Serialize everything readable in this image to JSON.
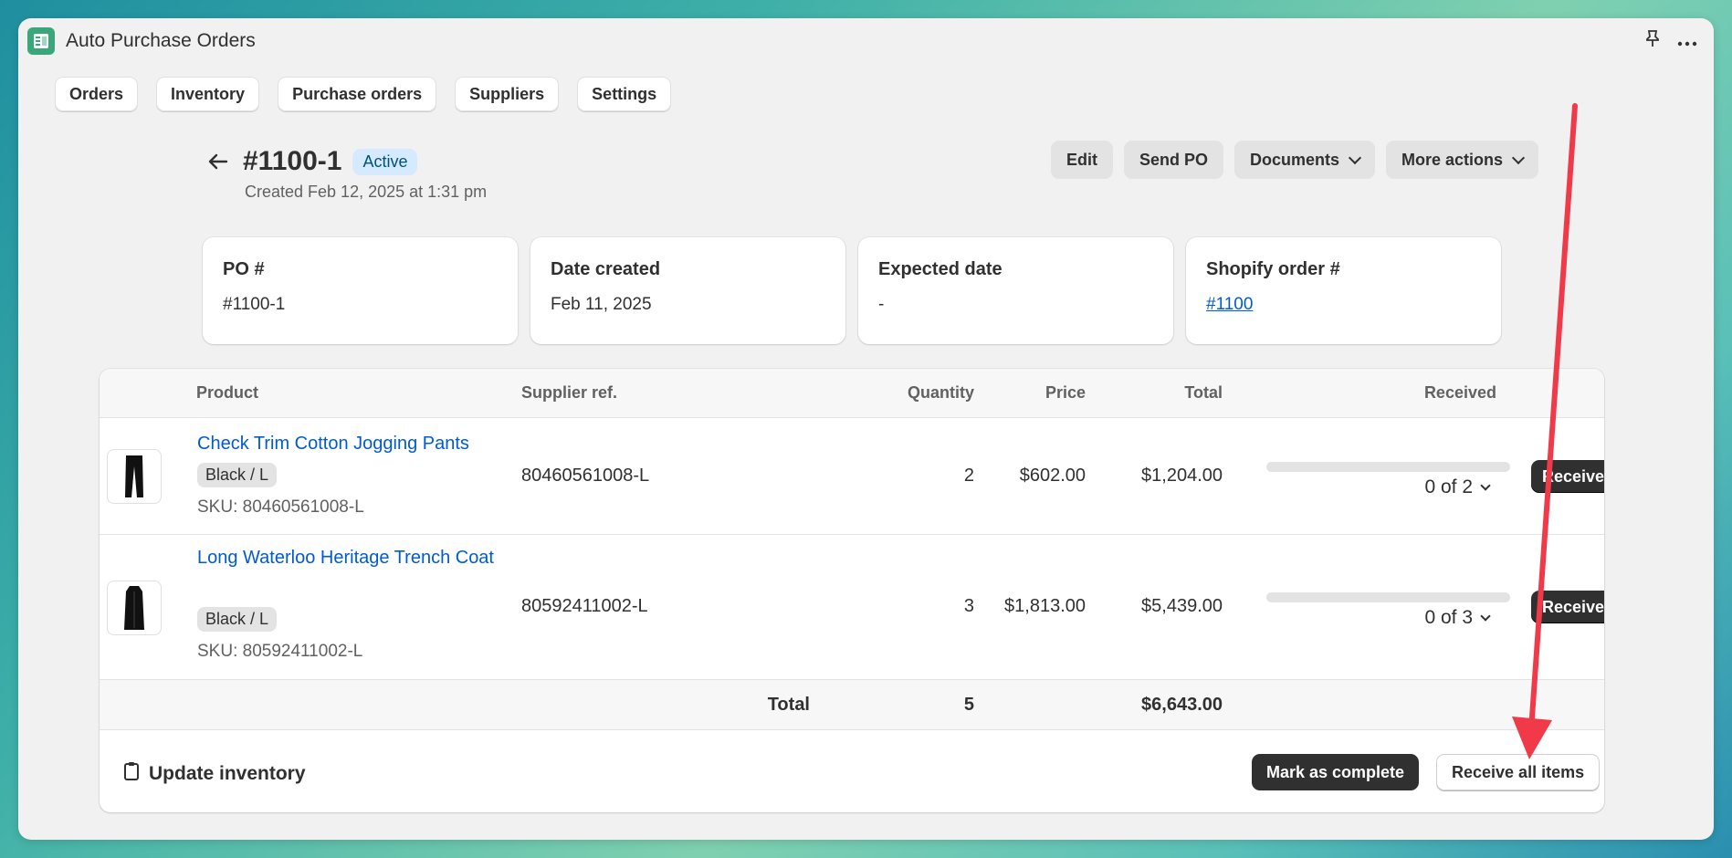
{
  "app": {
    "title": "Auto Purchase Orders"
  },
  "titlebar": {
    "pin_icon": "pin-icon",
    "more_icon": "more-horizontal-icon"
  },
  "nav": {
    "tabs": [
      "Orders",
      "Inventory",
      "Purchase orders",
      "Suppliers",
      "Settings"
    ]
  },
  "header": {
    "title": "#1100-1",
    "status": "Active",
    "created": "Created Feb 12, 2025 at 1:31 pm",
    "actions": {
      "edit": "Edit",
      "send": "Send PO",
      "documents": "Documents",
      "more": "More actions"
    }
  },
  "cards": [
    {
      "label": "PO #",
      "value": "#1100-1"
    },
    {
      "label": "Date created",
      "value": "Feb 11, 2025"
    },
    {
      "label": "Expected date",
      "value": "-"
    },
    {
      "label": "Shopify order #",
      "value": "#1100"
    }
  ],
  "table": {
    "headers": {
      "product": "Product",
      "supplier_ref": "Supplier ref.",
      "quantity": "Quantity",
      "price": "Price",
      "total": "Total",
      "received": "Received"
    },
    "rows": [
      {
        "name": "Check Trim Cotton Jogging Pants",
        "variant": "Black / L",
        "sku": "SKU: 80460561008-L",
        "supplier_ref": "80460561008-L",
        "quantity": "2",
        "price": "$602.00",
        "total": "$1,204.00",
        "received": "0 of 2",
        "received_fraction": 0,
        "receive_label": "Receive"
      },
      {
        "name": "Long Waterloo Heritage Trench Coat",
        "variant": "Black / L",
        "sku": "SKU: 80592411002-L",
        "supplier_ref": "80592411002-L",
        "quantity": "3",
        "price": "$1,813.00",
        "total": "$5,439.00",
        "received": "0 of 3",
        "received_fraction": 0,
        "receive_label": "Receive"
      }
    ],
    "totals": {
      "label": "Total",
      "quantity": "5",
      "amount": "$6,643.00"
    }
  },
  "footer": {
    "update_inventory": "Update inventory",
    "mark_complete": "Mark as complete",
    "receive_all": "Receive all items"
  },
  "colors": {
    "accent": "#005bd3",
    "badge_bg": "#d6eaff",
    "annotation_arrow": "#f03a4a"
  }
}
